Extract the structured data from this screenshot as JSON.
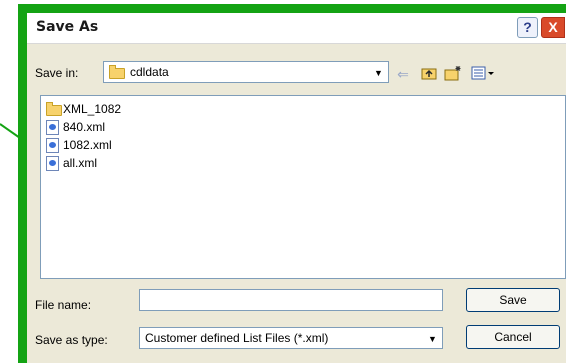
{
  "dialog": {
    "title": "Save As",
    "help_label": "?",
    "close_label": "X"
  },
  "save_in": {
    "label": "Save in:",
    "value": "cdldata"
  },
  "toolbar": {
    "icons": [
      "back-arrow-icon",
      "up-folder-icon",
      "new-folder-icon",
      "view-menu-icon"
    ]
  },
  "files": [
    {
      "name": "XML_1082",
      "type": "folder"
    },
    {
      "name": "840.xml",
      "type": "xml"
    },
    {
      "name": "1082.xml",
      "type": "xml"
    },
    {
      "name": "all.xml",
      "type": "xml"
    }
  ],
  "file_name": {
    "label": "File name:",
    "value": ""
  },
  "save_as_type": {
    "label": "Save as type:",
    "value": "Customer defined List Files (*.xml)"
  },
  "buttons": {
    "save": "Save",
    "cancel": "Cancel"
  },
  "colors": {
    "highlight": "#14a314",
    "dialog_bg": "#ece9d8",
    "field_border": "#7f9db9"
  }
}
